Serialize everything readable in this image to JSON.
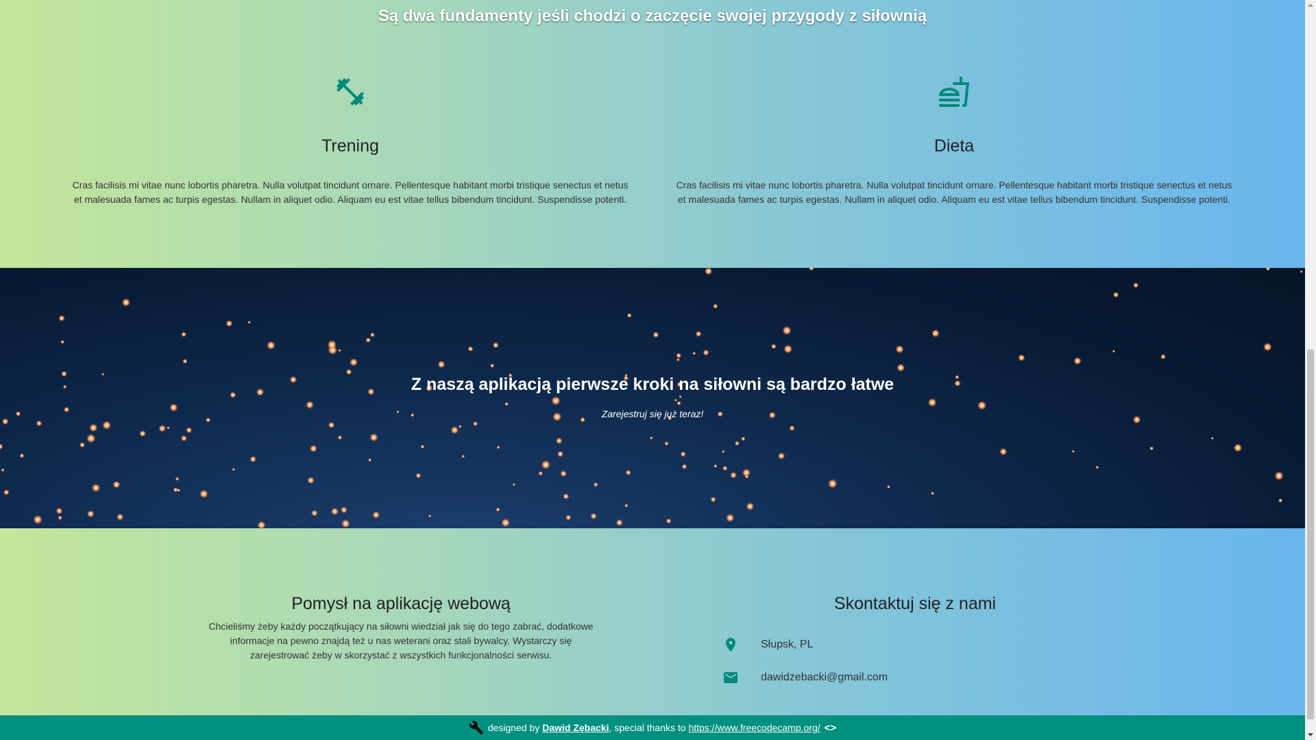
{
  "fundamentals": {
    "title": "Są dwa fundamenty jeśli chodzi o zaczęcie swojej przygody z siłownią",
    "columns": [
      {
        "icon": "dumbbell-icon",
        "heading": "Trening",
        "text": "Cras facilisis mi vitae nunc lobortis pharetra. Nulla volutpat tincidunt ornare. Pellentesque habitant morbi tristique senectus et netus et malesuada fames ac turpis egestas. Nullam in aliquet odio. Aliquam eu est vitae tellus bibendum tincidunt. Suspendisse potenti."
      },
      {
        "icon": "food-icon",
        "heading": "Dieta",
        "text": "Cras facilisis mi vitae nunc lobortis pharetra. Nulla volutpat tincidunt ornare. Pellentesque habitant morbi tristique senectus et netus et malesuada fames ac turpis egestas. Nullam in aliquet odio. Aliquam eu est vitae tellus bibendum tincidunt. Suspendisse potenti."
      }
    ]
  },
  "banner": {
    "title": "Z naszą aplikacją pierwsze kroki na siłowni są bardzo łatwe",
    "subtitle": "Zarejestruj się już teraz!"
  },
  "about": {
    "heading": "Pomysł na aplikację webową",
    "text": "Chcieliśmy żeby każdy początkujący na siłowni wiedział jak się do tego zabrać, dodatkowe informacje na pewno znajdą też u nas weterani oraz stali bywalcy. Wystarczy się zarejestrować żeby w skorzystać z wszystkich funkcjonalności serwisu."
  },
  "contact": {
    "heading": "Skontaktuj się z nami",
    "location": "Słupsk, PL",
    "email": "dawidzebacki@gmail.com"
  },
  "footer": {
    "prefix": "designed by",
    "author": "Dawid Zębacki",
    "thanks": ", special thanks to",
    "link": "https://www.freecodecamp.org/",
    "code_symbol": "<>"
  },
  "colors": {
    "accent": "#009080",
    "gradient_start": "#c3e69a",
    "gradient_end": "#69b6ee",
    "banner_bg": "#0a1f3c"
  }
}
